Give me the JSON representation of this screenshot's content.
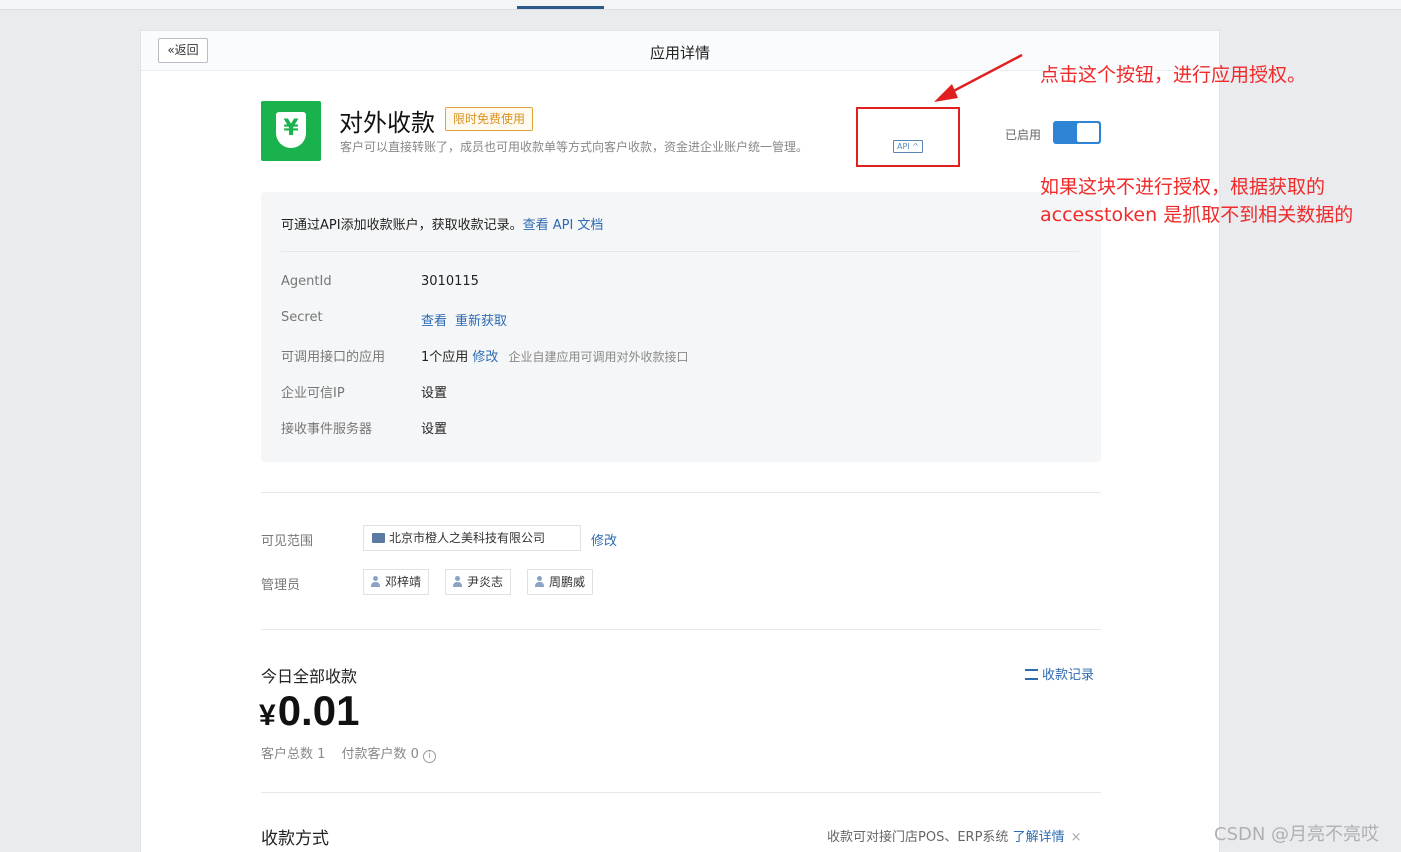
{
  "header": {
    "back_label": "«返回",
    "title": "应用详情"
  },
  "app": {
    "icon_glyph": "¥",
    "name": "对外收款",
    "badge": "限时免费使用",
    "description": "客户可以直接转账了，成员也可用收款单等方式向客户收款，资金进企业账户统一管理。",
    "api_tag": "API ^",
    "status_label": "已启用",
    "enabled": true
  },
  "api_section": {
    "intro": "可通过API添加收款账户，获取收款记录。",
    "doc_link": "查看 API 文档",
    "rows": [
      {
        "key": "AgentId",
        "value": "3010115"
      },
      {
        "key": "Secret",
        "link1": "查看",
        "link2": "重新获取"
      },
      {
        "key": "可调用接口的应用",
        "value": "1个应用",
        "link1": "修改",
        "note": "企业自建应用可调用对外收款接口"
      },
      {
        "key": "企业可信IP",
        "link1": "设置"
      },
      {
        "key": "接收事件服务器",
        "link1": "设置"
      }
    ]
  },
  "visibility": {
    "label": "可见范围",
    "org": "北京市橙人之美科技有限公司",
    "edit": "修改"
  },
  "admins": {
    "label": "管理员",
    "people": [
      "邓梓靖",
      "尹炎志",
      "周鹏威"
    ]
  },
  "today": {
    "title": "今日全部收款",
    "records_link": "收款记录",
    "currency": "¥",
    "amount": "0.01",
    "customers_total": "客户总数 1",
    "paying_customers": "付款客户数 0",
    "info_glyph": "i"
  },
  "payment": {
    "title": "收款方式",
    "note": "收款可对接门店POS、ERP系统",
    "learn_more": "了解详情",
    "close": "×"
  },
  "annotations": {
    "line1": "点击这个按钮，进行应用授权。",
    "line2": "如果这块不进行授权，根据获取的",
    "line3": "accesstoken 是抓取不到相关数据的",
    "color": "#f02a2a"
  },
  "watermark": "CSDN @月亮不亮哎",
  "colors": {
    "accent": "#2d6ab1",
    "app_green": "#1ab24c",
    "badge_orange": "#d9931f",
    "toggle_on": "#2e84d4"
  }
}
